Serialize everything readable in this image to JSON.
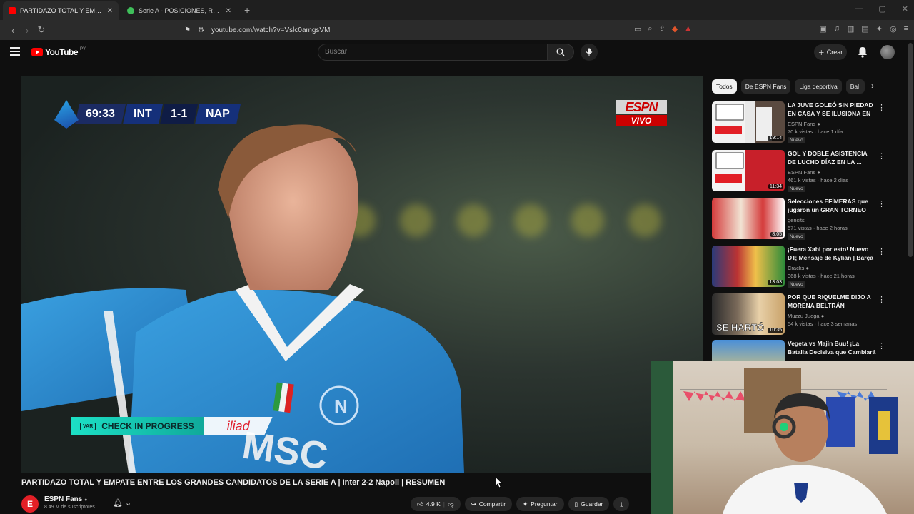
{
  "browser": {
    "tabs": [
      {
        "title": "PARTIDAZO TOTAL Y EMPATE EN",
        "active": true,
        "favicon_color": "#ff0000"
      },
      {
        "title": "Serie A - POSICIONES, RESULTADOS",
        "active": false,
        "favicon_color": "#3fbf5a"
      }
    ],
    "url": "youtube.com/watch?v=Vslc0amgsVM"
  },
  "youtube": {
    "logo_text": "YouTube",
    "logo_country": "PY",
    "search_placeholder": "Buscar",
    "create_label": "Crear"
  },
  "player": {
    "scoreboard": {
      "time": "69:33",
      "team_home": "INT",
      "score": "1-1",
      "team_away": "NAP"
    },
    "broadcaster": {
      "brand": "ESPN",
      "status": "VIVO"
    },
    "var_banner": {
      "badge": "VAR",
      "text": "CHECK IN PROGRESS",
      "sponsor": "iliad"
    },
    "jersey_text": "MSC"
  },
  "video": {
    "title": "PARTIDAZO TOTAL Y EMPATE ENTRE LOS GRANDES CANDIDATOS DE LA SERIE A | Inter 2-2 Napoli | RESUMEN",
    "channel": "ESPN Fans",
    "subscribers": "8.49 M de suscriptores",
    "likes": "4.9 K",
    "actions": {
      "share": "Compartir",
      "ask": "Preguntar",
      "save": "Guardar"
    }
  },
  "sidebar": {
    "chips": [
      "Todos",
      "De ESPN Fans",
      "Liga deportiva",
      "Bal"
    ],
    "recommendations": [
      {
        "title": "LA JUVE GOLEÓ SIN PIEDAD EN CASA Y SE ILUSIONA EN ...",
        "channel": "ESPN Fans",
        "meta": "70 k vistas · hace 1 día",
        "duration": "19:14",
        "badge": "Nuevo",
        "verified": true
      },
      {
        "title": "GOL Y DOBLE ASISTENCIA DE LUCHO DÍAZ EN LA ...",
        "channel": "ESPN Fans",
        "meta": "461 k vistas · hace 2 días",
        "duration": "11:34",
        "badge": "Nuevo",
        "verified": true
      },
      {
        "title": "Selecciones EFÍMERAS que jugaron un GRAN TORNEO",
        "channel": "gencits",
        "meta": "571 vistas · hace 2 horas",
        "duration": "8:05",
        "badge": "Nuevo",
        "verified": false
      },
      {
        "title": "¡Fuera Xabi por esto! Nuevo DT; Mensaje de Kylian | Barça en ...",
        "channel": "Cracks",
        "meta": "368 k vistas · hace 21 horas",
        "duration": "13:03",
        "badge": "Nuevo",
        "verified": true
      },
      {
        "title": "POR QUE RIQUELME DIJO A MORENA BELTRÁN",
        "channel": "Muzzu Juega",
        "meta": "54 k vistas · hace 3 semanas",
        "duration": "10:35",
        "badge": "",
        "verified": true
      },
      {
        "title": "Vegeta vs Majin Buu! ¡La Batalla Decisiva que Cambiará Todo! ...",
        "channel": "",
        "meta": "",
        "duration": "",
        "badge": "",
        "verified": false
      }
    ]
  }
}
